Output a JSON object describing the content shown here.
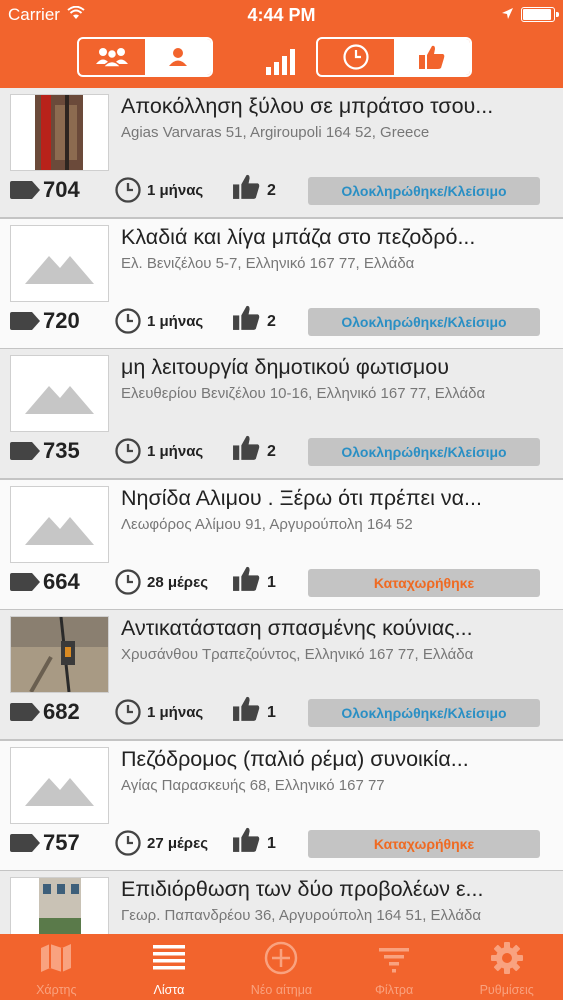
{
  "status_bar": {
    "carrier": "Carrier",
    "time": "4:44 PM"
  },
  "header": {
    "left_segment": {
      "selected": "mine",
      "options": [
        "all-users-icon",
        "user-icon"
      ]
    },
    "right_segment": {
      "selected": "likes",
      "options": [
        "clock-icon",
        "thumbs-up-icon"
      ]
    }
  },
  "colors": {
    "brand": "#f2642d",
    "completed": "#2a8fc4",
    "registered": "#ef6a22",
    "badge_bg": "#c4c4c4"
  },
  "reports": [
    {
      "title": "Αποκόλληση ξύλου σε μπράτσο τσου...",
      "address": "Agias Varvaras 51, Argiroupoli 164 52, Greece",
      "id": "704",
      "age": "1 μήνας",
      "likes": "2",
      "status": "Ολοκληρώθηκε/Κλείσιμο",
      "status_kind": "done",
      "thumb": "photo-slide"
    },
    {
      "title": "Κλαδιά και λίγα μπάζα στο πεζοδρό...",
      "address": "Ελ. Βενιζέλου 5-7, Ελληνικό 167 77, Ελλάδα",
      "id": "720",
      "age": "1 μήνας",
      "likes": "2",
      "status": "Ολοκληρώθηκε/Κλείσιμο",
      "status_kind": "done",
      "thumb": "placeholder"
    },
    {
      "title": "μη λειτουργία δημοτικού φωτισμου",
      "address": "Ελευθερίου Βενιζέλου 10-16, Ελληνικό 167 77, Ελλάδα",
      "id": "735",
      "age": "1 μήνας",
      "likes": "2",
      "status": "Ολοκληρώθηκε/Κλείσιμο",
      "status_kind": "done",
      "thumb": "placeholder"
    },
    {
      "title": "Νησίδα Αλιμου . Ξέρω ότι πρέπει να...",
      "address": "Λεωφόρος Αλίμου 91, Αργυρούπολη 164 52",
      "id": "664",
      "age": "28 μέρες",
      "likes": "1",
      "status": "Καταχωρήθηκε",
      "status_kind": "reg",
      "thumb": "placeholder"
    },
    {
      "title": "Αντικατάσταση σπασμένης κούνιας...",
      "address": "Χρυσάνθου Τραπεζούντος, Ελληνικό 167 77, Ελλάδα",
      "id": "682",
      "age": "1 μήνας",
      "likes": "1",
      "status": "Ολοκληρώθηκε/Κλείσιμο",
      "status_kind": "done",
      "thumb": "photo-swing"
    },
    {
      "title": "Πεζόδρομος (παλιό ρέμα) συνοικία...",
      "address": "Αγίας Παρασκευής 68, Ελληνικό 167 77",
      "id": "757",
      "age": "27 μέρες",
      "likes": "1",
      "status": "Καταχωρήθηκε",
      "status_kind": "reg",
      "thumb": "placeholder"
    },
    {
      "title": "Επιδιόρθωση των δύο προβολέων ε...",
      "address": "Γεωρ. Παπανδρέου 36, Αργυρούπολη 164 51, Ελλάδα",
      "id": "",
      "age": "",
      "likes": "",
      "status": "",
      "status_kind": "",
      "thumb": "photo-building"
    }
  ],
  "tabbar": {
    "active": "list",
    "items": [
      {
        "label": "Χάρτης",
        "icon": "map-icon"
      },
      {
        "label": "Λίστα",
        "icon": "list-icon"
      },
      {
        "label": "Νέο αίτημα",
        "icon": "add-circle-icon"
      },
      {
        "label": "Φίλτρα",
        "icon": "filter-icon"
      },
      {
        "label": "Ρυθμίσεις",
        "icon": "settings-gear-icon"
      }
    ]
  }
}
